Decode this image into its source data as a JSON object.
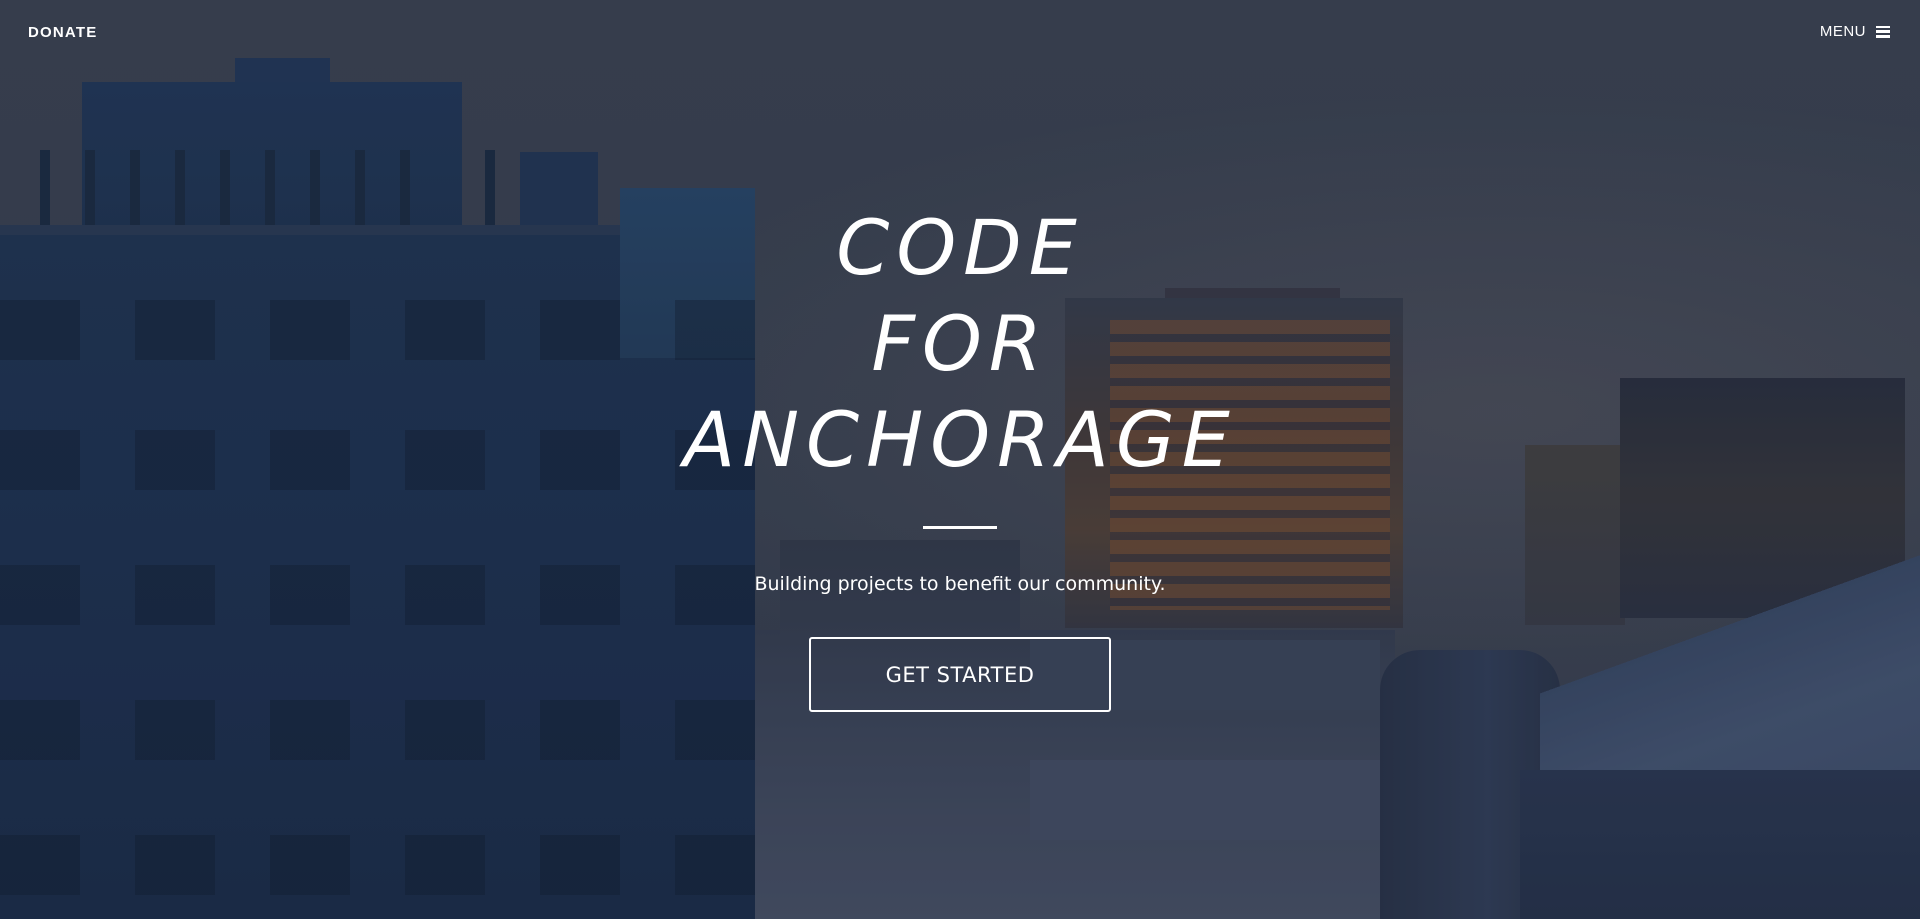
{
  "nav": {
    "donate_label": "DONATE",
    "menu_label": "MENU",
    "menu_icon": "hamburger-icon"
  },
  "hero": {
    "title_lines": [
      "CODE",
      "FOR",
      "ANCHORAGE"
    ],
    "subtitle": "Building projects to benefit our community.",
    "cta_label": "GET STARTED",
    "background": "cityscape-photo"
  },
  "colors": {
    "text": "#ffffff",
    "overlay": "#1e283c"
  }
}
